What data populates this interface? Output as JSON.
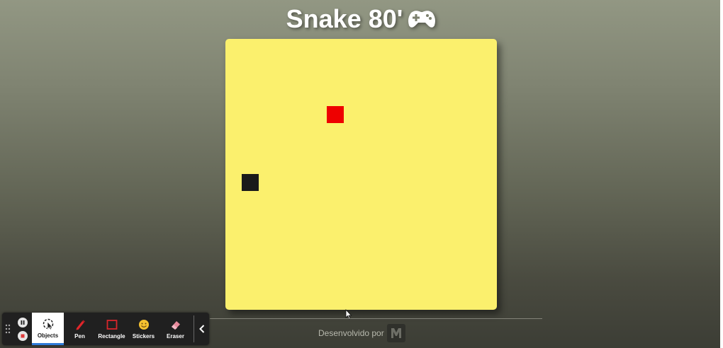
{
  "header": {
    "title": "Snake 80'",
    "icon": "gamepad-icon"
  },
  "game": {
    "board_color": "#fbf06d",
    "food_color": "#ee0000",
    "snake_color": "#1a1a1a"
  },
  "footer": {
    "credit": "Desenvolvido por",
    "logo": "developer-logo"
  },
  "toolbar": {
    "tools": [
      {
        "id": "objects",
        "label": "Objects",
        "icon": "cursor-select-icon",
        "active": true
      },
      {
        "id": "pen",
        "label": "Pen",
        "icon": "pen-icon",
        "active": false
      },
      {
        "id": "rectangle",
        "label": "Rectangle",
        "icon": "rectangle-icon",
        "active": false
      },
      {
        "id": "stickers",
        "label": "Stickers",
        "icon": "sticker-icon",
        "active": false
      },
      {
        "id": "eraser",
        "label": "Eraser",
        "icon": "eraser-icon",
        "active": false
      }
    ]
  }
}
